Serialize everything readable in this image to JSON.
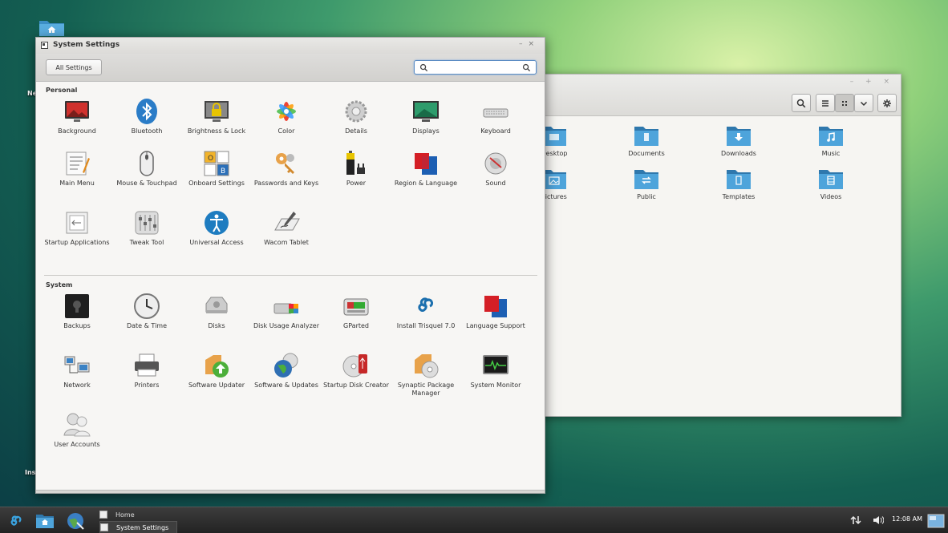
{
  "desktop": {
    "labels": [
      "Ne",
      "Ins"
    ]
  },
  "file_manager": {
    "folders": [
      {
        "label": "Desktop",
        "icon": "desktop-folder-icon"
      },
      {
        "label": "Documents",
        "icon": "documents-folder-icon"
      },
      {
        "label": "Downloads",
        "icon": "downloads-folder-icon"
      },
      {
        "label": "Music",
        "icon": "music-folder-icon"
      },
      {
        "label": "Pictures",
        "icon": "pictures-folder-icon"
      },
      {
        "label": "Public",
        "icon": "public-folder-icon"
      },
      {
        "label": "Templates",
        "icon": "templates-folder-icon"
      },
      {
        "label": "Videos",
        "icon": "videos-folder-icon"
      }
    ],
    "controls": "– + ×"
  },
  "settings": {
    "title": "System Settings",
    "all_settings": "All Settings",
    "search_placeholder": "",
    "personal_title": "Personal",
    "system_title": "System",
    "personal": [
      {
        "label": "Background"
      },
      {
        "label": "Bluetooth"
      },
      {
        "label": "Brightness & Lock"
      },
      {
        "label": "Color"
      },
      {
        "label": "Details"
      },
      {
        "label": "Displays"
      },
      {
        "label": "Keyboard"
      },
      {
        "label": "Main Menu"
      },
      {
        "label": "Mouse & Touchpad"
      },
      {
        "label": "Onboard Settings"
      },
      {
        "label": "Passwords and Keys"
      },
      {
        "label": "Power"
      },
      {
        "label": "Region & Language"
      },
      {
        "label": "Sound"
      },
      {
        "label": "Startup Applications"
      },
      {
        "label": "Tweak Tool"
      },
      {
        "label": "Universal Access"
      },
      {
        "label": "Wacom Tablet"
      }
    ],
    "system": [
      {
        "label": "Backups"
      },
      {
        "label": "Date & Time"
      },
      {
        "label": "Disks"
      },
      {
        "label": "Disk Usage Analyzer"
      },
      {
        "label": "GParted"
      },
      {
        "label": "Install Trisquel 7.0"
      },
      {
        "label": "Language Support"
      },
      {
        "label": "Network"
      },
      {
        "label": "Printers"
      },
      {
        "label": "Software Updater"
      },
      {
        "label": "Software & Updates"
      },
      {
        "label": "Startup Disk Creator"
      },
      {
        "label": "Synaptic Package Manager"
      },
      {
        "label": "System Monitor"
      },
      {
        "label": "User Accounts"
      }
    ]
  },
  "taskbar": {
    "tasks": [
      {
        "label": "Home"
      },
      {
        "label": "System Settings"
      }
    ],
    "clock": "12:08 AM"
  },
  "colors": {
    "folder_blue": "#3d8fc6",
    "search_focus": "#5b8cc4"
  }
}
